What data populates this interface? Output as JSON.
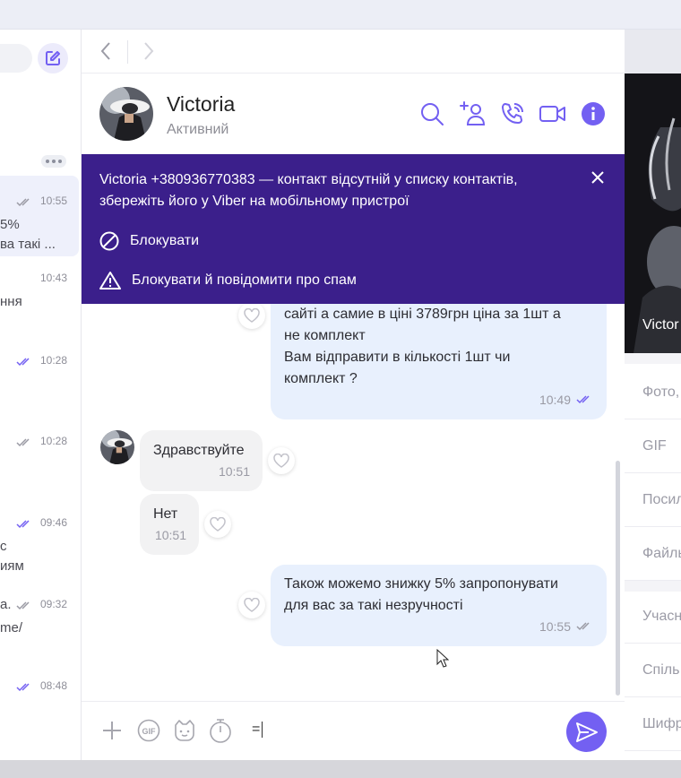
{
  "sidebar": {
    "items": [
      {
        "time": "10:55",
        "preview": [
          "5%",
          "ва такі ..."
        ],
        "ticks": "read-gray",
        "active": true
      },
      {
        "time": "10:43",
        "preview": [
          "ння"
        ],
        "ticks": "none"
      },
      {
        "time": "10:28",
        "preview": [],
        "ticks": "read-purple"
      },
      {
        "time": "10:28",
        "preview": [],
        "ticks": "read-gray"
      },
      {
        "time": "09:46",
        "preview": [
          "с",
          "иям"
        ],
        "ticks": "read-purple"
      },
      {
        "time": "09:32",
        "preview": [
          "а.",
          "me/"
        ],
        "ticks": "read-gray"
      },
      {
        "time": "08:48",
        "preview": [],
        "ticks": "read-purple"
      }
    ]
  },
  "chat": {
    "name": "Victoria",
    "status": "Активний"
  },
  "banner": {
    "text": "Victoria +380936770383 — контакт відсутній у списку контактів, збережіть його у Viber на мобільному пристрої",
    "block_label": "Блокувати",
    "block_spam_label": "Блокувати й повідомити про спам"
  },
  "messages": [
    {
      "direction": "out",
      "text": "сайті а самие в ціні 3789грн ціна за 1шт а\nне комплект\nВам відправити в кількості  1шт чи\nкомплект ?",
      "time": "10:49",
      "status": "read"
    },
    {
      "direction": "in",
      "text": "Здравствуйте",
      "time": "10:51"
    },
    {
      "direction": "in",
      "text": "Нет",
      "time": "10:51"
    },
    {
      "direction": "out",
      "text": "Також можемо знижку 5% запропонувати\nдля вас за такі незручності",
      "time": "10:55",
      "status": "delivered"
    }
  ],
  "composer": {
    "input_value": "="
  },
  "right_panel": {
    "name": "Victor",
    "items": [
      "Фото,",
      "GIF",
      "Посил",
      "Файлы",
      "Учасн",
      "Спіль",
      "Шифр"
    ]
  },
  "colors": {
    "accent": "#7360f2",
    "banner": "#3b1f8b",
    "bubble_out": "#e8f0fd",
    "bubble_in": "#f2f2f3"
  }
}
